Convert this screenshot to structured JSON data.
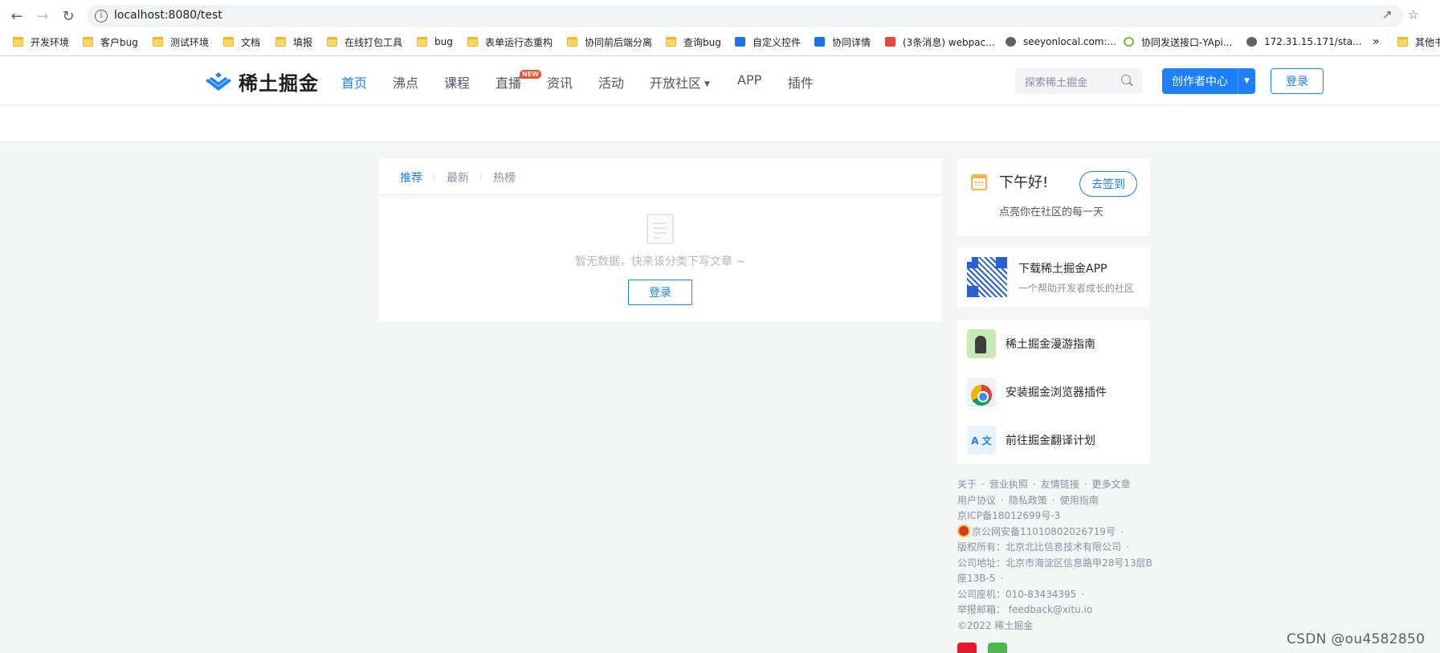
{
  "browser": {
    "url": "localhost:8080/test",
    "bookmarks": [
      {
        "label": "开发环境",
        "icon": "folder"
      },
      {
        "label": "客户bug",
        "icon": "folder"
      },
      {
        "label": "测试环境",
        "icon": "folder"
      },
      {
        "label": "文档",
        "icon": "folder"
      },
      {
        "label": "填报",
        "icon": "folder"
      },
      {
        "label": "在线打包工具",
        "icon": "folder"
      },
      {
        "label": "bug",
        "icon": "folder"
      },
      {
        "label": "表单运行态重构",
        "icon": "folder"
      },
      {
        "label": "协同前后端分离",
        "icon": "folder"
      },
      {
        "label": "查询bug",
        "icon": "folder"
      },
      {
        "label": "自定义控件",
        "icon": "blue"
      },
      {
        "label": "协同详情",
        "icon": "blue"
      },
      {
        "label": "(3条消息) webpac...",
        "icon": "red"
      },
      {
        "label": "seeyonlocal.com:...",
        "icon": "globe"
      },
      {
        "label": "协同发送接口-YApi...",
        "icon": "yapi"
      },
      {
        "label": "172.31.15.171/sta...",
        "icon": "globe"
      },
      {
        "label": "其他书签",
        "icon": "folder"
      }
    ],
    "more_bookmarks": "»"
  },
  "header": {
    "logo_text": "稀土掘金",
    "nav": [
      "首页",
      "沸点",
      "课程",
      "直播",
      "资讯",
      "活动",
      "开放社区",
      "APP",
      "插件"
    ],
    "new_badge": "NEW",
    "search_placeholder": "探索稀土掘金",
    "creator_label": "创作者中心",
    "login_label": "登录"
  },
  "feed": {
    "tabs": [
      "推荐",
      "最新",
      "热榜"
    ],
    "empty_text": "暂无数据，快来该分类下写文章 ~",
    "login_label": "登录"
  },
  "sidebar": {
    "greeting": "下午好!",
    "greeting_sub": "点亮你在社区的每一天",
    "checkin_label": "去签到",
    "app_title": "下载稀土掘金APP",
    "app_sub": "一个帮助开发者成长的社区",
    "links": [
      "稀土掘金漫游指南",
      "安装掘金浏览器插件",
      "前往掘金翻译计划"
    ],
    "translate_icon_text": "A 文"
  },
  "footer": {
    "row1": [
      "关于",
      "营业执照",
      "友情链接",
      "更多文章"
    ],
    "row2": [
      "用户协议",
      "隐私政策",
      "使用指南"
    ],
    "icp": "京ICP备18012699号-3",
    "police": "京公网安备11010802026719号",
    "copyright_owner": "版权所有：北京北比信息技术有限公司",
    "address_1": "公司地址：北京市海淀区信息路甲28号13层B",
    "address_2": "座13B-5",
    "phone": "公司座机：010-83434395",
    "email": "举报邮箱： feedback@xitu.io",
    "copyright": "©2022 稀土掘金"
  },
  "watermark": "CSDN @ou4582850",
  "colors": {
    "brand": "#1e80ff",
    "badge": "#ee502f",
    "page_bg": "#f4f5f5"
  }
}
